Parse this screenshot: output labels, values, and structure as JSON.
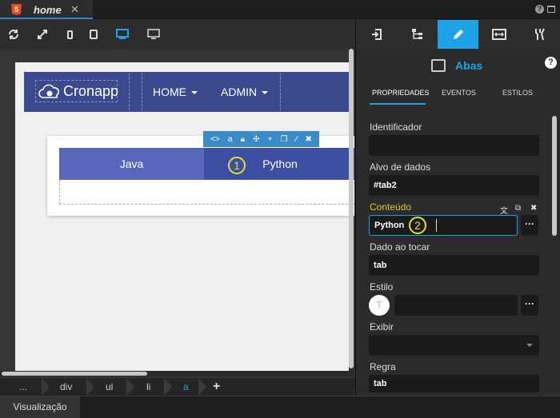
{
  "tabbar": {
    "file_title": "home",
    "close_glyph": "✕",
    "help_glyph": "?"
  },
  "toolbar": {
    "icons": [
      "refresh-icon",
      "fullscreen-icon",
      "phone-icon",
      "tablet-icon",
      "desktop-icon",
      "monitor-icon"
    ],
    "active": "desktop-icon"
  },
  "canvas": {
    "brand": "Cronapp",
    "nav": [
      "HOME",
      "ADMIN"
    ],
    "tabs": [
      "Java",
      "Python"
    ],
    "active_tab": "Python",
    "comp_toolbar": [
      "<>",
      "a",
      "lock",
      "move",
      "+",
      "copy",
      "wand",
      "✖"
    ],
    "markers": [
      "1",
      "2"
    ]
  },
  "breadcrumb": {
    "items": [
      "...",
      "div",
      "ul",
      "li",
      "a"
    ],
    "active": "a",
    "add": "+"
  },
  "bottom": {
    "view_label": "Visualização"
  },
  "panel": {
    "tabs": [
      "import-icon",
      "tree-icon",
      "pencil-icon",
      "resize-icon",
      "wrench-icon"
    ],
    "active_tab": "pencil-icon",
    "component": "Abas",
    "help": "?",
    "subtabs": [
      "PROPRIEDADES",
      "EVENTOS",
      "ESTILOS"
    ],
    "active_subtab": "PROPRIEDADES",
    "fields": {
      "identificador": {
        "label": "Identificador",
        "value": ""
      },
      "alvo": {
        "label": "Alvo de dados",
        "value": "#tab2"
      },
      "conteudo": {
        "label": "Conteúdo",
        "value": "Python"
      },
      "dado": {
        "label": "Dado ao tocar",
        "value": "tab"
      },
      "estilo": {
        "label": "Estilo",
        "value": "",
        "avatar": "T"
      },
      "exibir": {
        "label": "Exibir",
        "value": ""
      },
      "regra": {
        "label": "Regra",
        "value": "tab"
      }
    },
    "dots": "···"
  },
  "colors": {
    "accent": "#1fa3e8",
    "navbar": "#3b4a8f",
    "tab_java": "#5867bd",
    "tab_python": "#3d4fa3",
    "marker": "#e3e031"
  }
}
